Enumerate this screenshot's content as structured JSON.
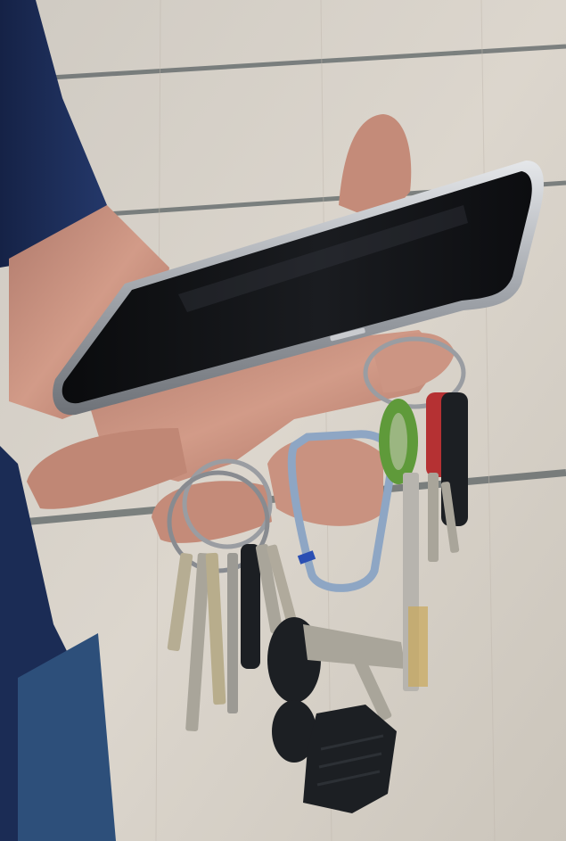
{
  "scene": {
    "subject": "hand-holding-smartphone-and-keys",
    "colors": {
      "floor": "#d8d2c8",
      "floor_stripe": "#2e3b40",
      "shirt": "#1b2c55",
      "jeans": "#2d4f7a",
      "skin": "#c68f7e",
      "phone_frame": "#b9bcc1",
      "phone_screen": "#101114",
      "carabiner": "#8ea6c4",
      "key_metal": "#a9a59a",
      "green_cap": "#5f9a3a",
      "red_cap": "#b53133",
      "black_fob": "#1c1f23"
    }
  }
}
